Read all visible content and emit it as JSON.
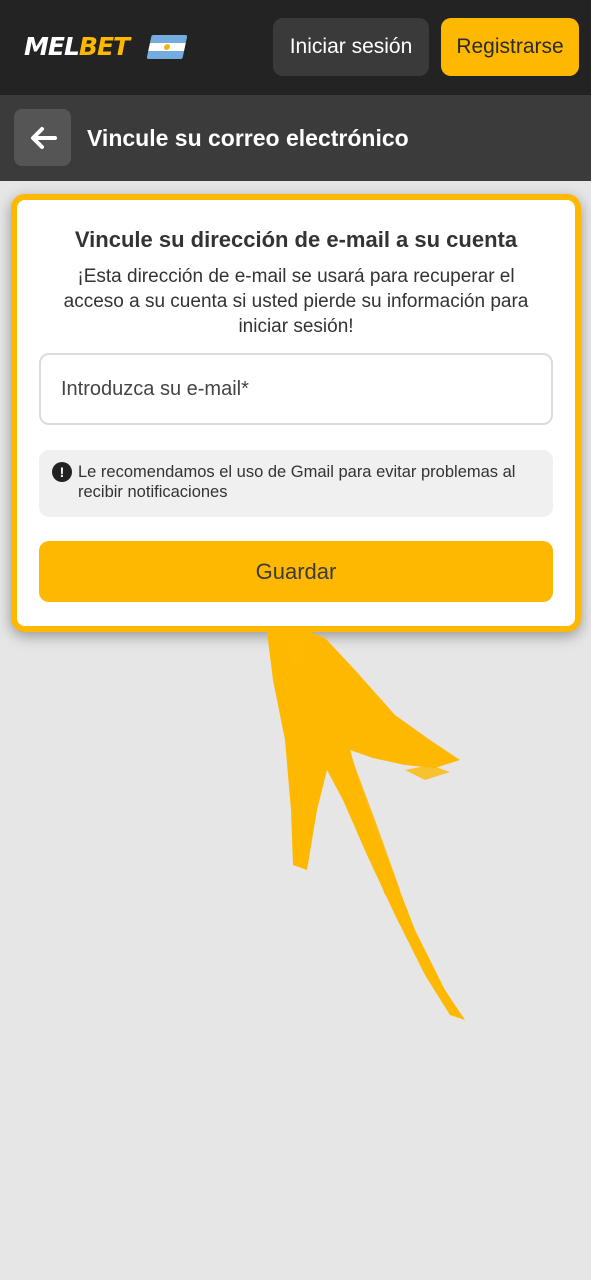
{
  "header": {
    "logo_part1": "MEL",
    "logo_part2": "BET",
    "flag_icon": "argentina-flag-icon",
    "login_label": "Iniciar sesión",
    "register_label": "Registrarse"
  },
  "subheader": {
    "back_icon": "arrow-left-icon",
    "title": "Vincule su correo electrónico"
  },
  "card": {
    "title": "Vincule su dirección de e-mail a su cuenta",
    "description": "¡Esta dirección de e-mail se usará para recuperar el acceso a su cuenta si usted pierde su información para iniciar sesión!",
    "email_placeholder": "Introduzca su e-mail*",
    "email_value": "",
    "notice_icon": "exclamation-icon",
    "notice_text": "Le recomendamos el uso de Gmail para evitar problemas al recibir notificaciones",
    "save_label": "Guardar"
  },
  "colors": {
    "accent": "#ffb800",
    "header_bg": "#232323",
    "subheader_bg": "#3b3b3b",
    "page_bg": "#e6e6e6"
  }
}
